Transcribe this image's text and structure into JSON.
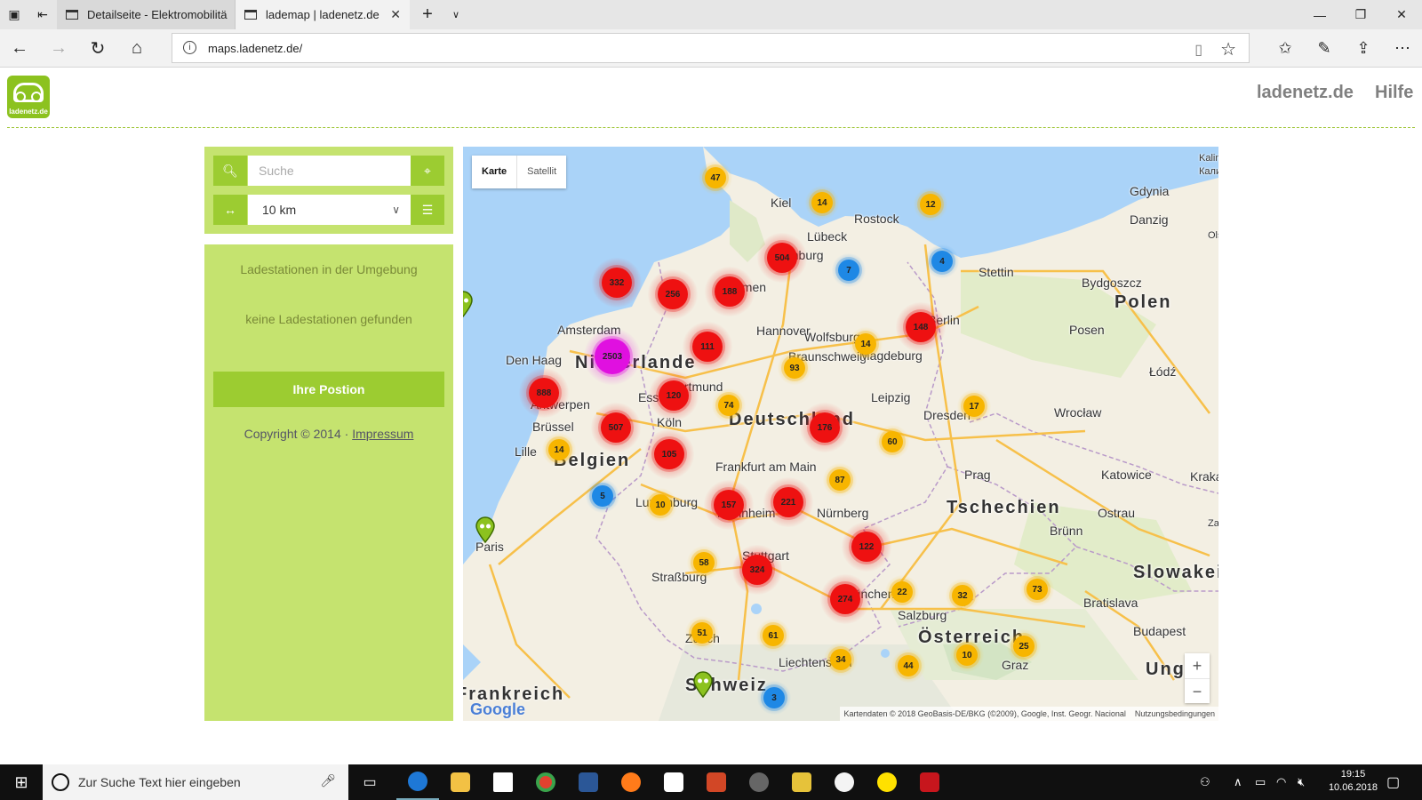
{
  "browser": {
    "tabs": [
      {
        "label": "Detailseite - Elektromobilitä",
        "active": false
      },
      {
        "label": "lademap | ladenetz.de",
        "active": true
      }
    ],
    "url": "maps.ladenetz.de/"
  },
  "site": {
    "logo_text": "ladenetz.de",
    "nav": [
      "ladenetz.de",
      "Hilfe"
    ]
  },
  "search": {
    "placeholder": "Suche",
    "radius": "10 km"
  },
  "info": {
    "heading": "Ladestationen in der Umgebung",
    "empty": "keine Ladestationen gefunden",
    "position_button": "Ihre Postion",
    "copyright": "Copyright © 2014 ·",
    "impressum": "Impressum"
  },
  "map": {
    "map_type_buttons": [
      "Karte",
      "Satellit"
    ],
    "selected_type": "Karte",
    "attribution": "Kartendaten © 2018 GeoBasis-DE/BKG (©2009), Google, Inst. Geogr. Nacional",
    "terms": "Nutzungsbedingungen",
    "google": "Google",
    "zoom_in": "+",
    "zoom_out": "−",
    "cities": [
      "Gdynia",
      "Danzig",
      "Kiel",
      "Rostock",
      "Lübeck",
      "Hamburg",
      "Stettin",
      "Bydgoszcz",
      "Bremen",
      "Amsterdam",
      "Hannover",
      "Wolfsburg",
      "Braunschweig",
      "Magdeburg",
      "Berlin",
      "Posen",
      "Den Haag",
      "Dortmund",
      "Essen",
      "Antwerpen",
      "Leipzig",
      "Łódź",
      "Brüssel",
      "Köln",
      "Dresden",
      "Wrocław",
      "Lille",
      "Frankfurt am Main",
      "Prag",
      "Katowice",
      "Krakau",
      "Luxemburg",
      "Mannheim",
      "Nürnberg",
      "Ostrau",
      "Brünn",
      "Paris",
      "Stuttgart",
      "Straßburg",
      "München",
      "Salzburg",
      "Bratislava",
      "Zürich",
      "Liechtenstein",
      "Graz",
      "Budapest",
      "Kalin",
      "Калин",
      "Ols",
      "Zakopan"
    ],
    "countries": [
      "Polen",
      "Niederlande",
      "Deutschland",
      "Belgien",
      "Tschechien",
      "Slowakei",
      "Österreich",
      "Schweiz",
      "Frankreich",
      "Ung"
    ],
    "clusters": [
      {
        "count": 47,
        "level": "yellow"
      },
      {
        "count": 14,
        "level": "yellow"
      },
      {
        "count": 12,
        "level": "yellow"
      },
      {
        "count": 504,
        "level": "red"
      },
      {
        "count": 7,
        "level": "blue"
      },
      {
        "count": 4,
        "level": "blue"
      },
      {
        "count": 332,
        "level": "red"
      },
      {
        "count": 256,
        "level": "red"
      },
      {
        "count": 188,
        "level": "red"
      },
      {
        "count": 148,
        "level": "red"
      },
      {
        "count": 111,
        "level": "red"
      },
      {
        "count": 14,
        "level": "yellow"
      },
      {
        "count": 2503,
        "level": "magenta"
      },
      {
        "count": 93,
        "level": "yellow"
      },
      {
        "count": 888,
        "level": "red"
      },
      {
        "count": 120,
        "level": "red"
      },
      {
        "count": 74,
        "level": "yellow"
      },
      {
        "count": 17,
        "level": "yellow"
      },
      {
        "count": 507,
        "level": "red"
      },
      {
        "count": 176,
        "level": "red"
      },
      {
        "count": 60,
        "level": "yellow"
      },
      {
        "count": 14,
        "level": "yellow"
      },
      {
        "count": 105,
        "level": "red"
      },
      {
        "count": 87,
        "level": "yellow"
      },
      {
        "count": 5,
        "level": "blue"
      },
      {
        "count": 10,
        "level": "yellow"
      },
      {
        "count": 157,
        "level": "red"
      },
      {
        "count": 221,
        "level": "red"
      },
      {
        "count": 122,
        "level": "red"
      },
      {
        "count": 58,
        "level": "yellow"
      },
      {
        "count": 324,
        "level": "red"
      },
      {
        "count": 22,
        "level": "yellow"
      },
      {
        "count": 32,
        "level": "yellow"
      },
      {
        "count": 274,
        "level": "red"
      },
      {
        "count": 73,
        "level": "yellow"
      },
      {
        "count": 51,
        "level": "yellow"
      },
      {
        "count": 61,
        "level": "yellow"
      },
      {
        "count": 34,
        "level": "yellow"
      },
      {
        "count": 44,
        "level": "yellow"
      },
      {
        "count": 10,
        "level": "yellow"
      },
      {
        "count": 25,
        "level": "yellow"
      },
      {
        "count": 3,
        "level": "blue"
      }
    ],
    "pins": 3
  },
  "taskbar": {
    "search_placeholder": "Zur Suche Text hier eingeben",
    "time": "19:15",
    "date": "10.06.2018"
  },
  "colors": {
    "brand_green": "#9ccc31",
    "panel_green": "#c5e36f",
    "cluster_red": "#ee1111",
    "cluster_yellow": "#f7b500",
    "cluster_blue": "#1e88e5",
    "cluster_magenta": "#e010e0"
  }
}
